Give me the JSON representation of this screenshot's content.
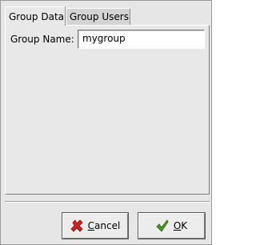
{
  "tabs": [
    {
      "label": "Group Data",
      "active": true
    },
    {
      "label": "Group Users",
      "active": false
    }
  ],
  "group_data": {
    "name_label": "Group Name:",
    "name_value": "mygroup"
  },
  "buttons": {
    "cancel": {
      "mnemonic": "C",
      "rest": "ancel",
      "icon": "cancel-x-icon",
      "icon_color": "#cc2222"
    },
    "ok": {
      "mnemonic": "O",
      "rest": "K",
      "icon": "checkmark-icon",
      "icon_color": "#3a8a1a"
    }
  }
}
